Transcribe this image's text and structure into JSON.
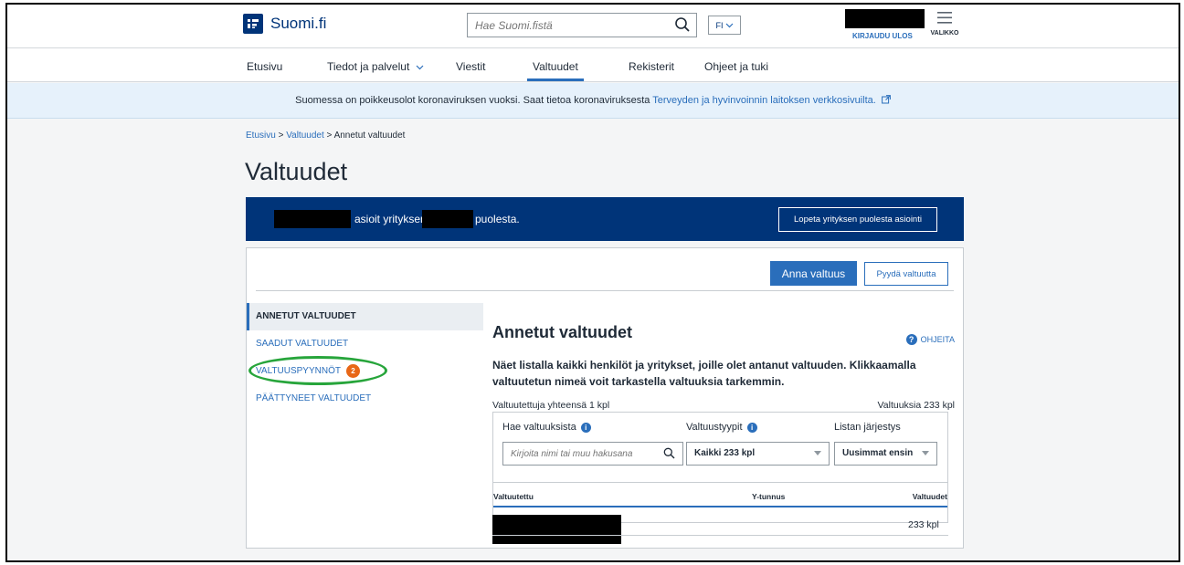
{
  "header": {
    "logo_text": "Suomi.fi",
    "search_placeholder": "Hae Suomi.fistä",
    "lang": "FI",
    "logout": "KIRJAUDU ULOS",
    "menu": "VALIKKO"
  },
  "nav": {
    "items": [
      "Etusivu",
      "Tiedot ja palvelut",
      "Viestit",
      "Valtuudet",
      "Rekisterit",
      "Ohjeet ja tuki"
    ],
    "active": "Valtuudet"
  },
  "notice": {
    "text": "Suomessa on poikkeusolot koronaviruksen vuoksi. Saat tietoa koronaviruksesta ",
    "link": "Terveyden ja hyvinvoinnin laitoksen verkkosivuilta."
  },
  "breadcrumb": {
    "home": "Etusivu",
    "sep1": ">",
    "parent": "Valtuudet",
    "sep2": ">",
    "current": "Annetut valtuudet"
  },
  "page_title": "Valtuudet",
  "banner": {
    "text_mid": "asioit yrityksen",
    "text_end": "puolesta.",
    "button": "Lopeta yrityksen puolesta asiointi"
  },
  "actions": {
    "primary": "Anna valtuus",
    "secondary": "Pyydä valtuutta"
  },
  "sidemenu": {
    "items": [
      "ANNETUT VALTUUDET",
      "SAADUT VALTUUDET",
      "VALTUUSPYYNNÖT",
      "PÄÄTTYNEET VALTUUDET"
    ],
    "badge": "2"
  },
  "content": {
    "title": "Annetut valtuudet",
    "help": "OHJEITA",
    "help_icon": "?",
    "description": "Näet listalla kaikki henkilöt ja yritykset, joille olet antanut valtuuden. Klikkaamalla valtuutetun nimeä voit tarkastella valtuuksia tarkemmin.",
    "total_left": "Valtuutettuja yhteensä 1 kpl",
    "total_right": "Valtuuksia 233 kpl"
  },
  "filters": {
    "search_label": "Hae valtuuksista",
    "search_placeholder": "Kirjoita nimi tai muu hakusana",
    "type_label": "Valtuustyypit",
    "type_value": "Kaikki 233 kpl",
    "order_label": "Listan järjestys",
    "order_value": "Uusimmat ensin",
    "info_icon": "i"
  },
  "table": {
    "headers": [
      "Valtuutettu",
      "Y-tunnus",
      "Valtuudet"
    ],
    "rows": [
      {
        "valtuudet": "233 kpl"
      }
    ]
  },
  "colors": {
    "brand": "#003479",
    "link": "#2a6ebb",
    "badge": "#e86717",
    "highlight_ring": "#27a53b"
  }
}
